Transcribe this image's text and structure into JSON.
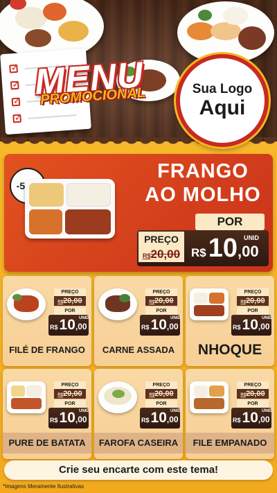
{
  "header": {
    "title_line1": "MENU",
    "title_line2": "PROMOCIONAL",
    "logo_line1": "Sua Logo",
    "logo_line2": "Aqui"
  },
  "featured": {
    "discount": "-50%",
    "name_line1": "FRANGO",
    "name_line2": "AO MOLHO",
    "preco_label": "PREÇO",
    "old_currency": "R$",
    "old_price": "20,00",
    "por_label": "POR",
    "unid_label": "UNID",
    "currency": "R$",
    "price_int": "10",
    "price_dec": ",00"
  },
  "items": [
    {
      "name": "FILÉ DE FRANGO",
      "preco_label": "PREÇO",
      "old_currency": "R$",
      "old_price": "20,00",
      "por_label": "POR",
      "unid_label": "UNID",
      "currency": "R$",
      "price_int": "10",
      "price_dec": ",00"
    },
    {
      "name": "CARNE ASSADA",
      "preco_label": "PREÇO",
      "old_currency": "R$",
      "old_price": "20,00",
      "por_label": "POR",
      "unid_label": "UNID",
      "currency": "R$",
      "price_int": "10",
      "price_dec": ",00"
    },
    {
      "name": "NHOQUE",
      "preco_label": "PREÇO",
      "old_currency": "R$",
      "old_price": "20,00",
      "por_label": "POR",
      "unid_label": "UNID",
      "currency": "R$",
      "price_int": "10",
      "price_dec": ",00"
    },
    {
      "name": "PURE DE BATATA",
      "preco_label": "PREÇO",
      "old_currency": "R$",
      "old_price": "20,00",
      "por_label": "POR",
      "unid_label": "UNID",
      "currency": "R$",
      "price_int": "10",
      "price_dec": ",00"
    },
    {
      "name": "FAROFA CASEIRA",
      "preco_label": "PREÇO",
      "old_currency": "R$",
      "old_price": "20,00",
      "por_label": "POR",
      "unid_label": "UNID",
      "currency": "R$",
      "price_int": "10",
      "price_dec": ",00"
    },
    {
      "name": "FILE EMPANADO",
      "preco_label": "PREÇO",
      "old_currency": "R$",
      "old_price": "20,00",
      "por_label": "POR",
      "unid_label": "UNID",
      "currency": "R$",
      "price_int": "10",
      "price_dec": ",00"
    }
  ],
  "footer": {
    "cta": "Crie seu encarte com este tema!",
    "disclaimer": "*Imagens Meramente Ilustrativas"
  },
  "colors": {
    "brand_red": "#c72a21",
    "accent_yellow": "#f7b51d",
    "wood_brown": "#5a3420",
    "card_bg": "#f9d9a6"
  }
}
